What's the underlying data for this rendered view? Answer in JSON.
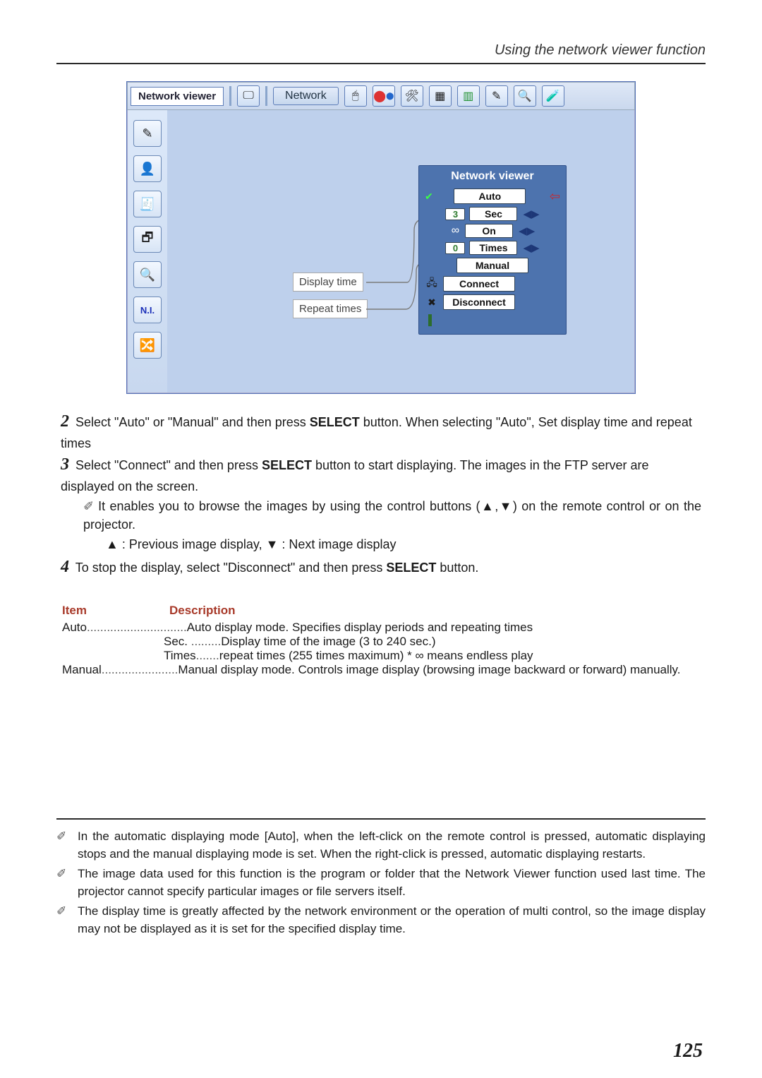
{
  "header": {
    "section_title": "Using the network viewer function"
  },
  "figure": {
    "header": {
      "title": "Network viewer",
      "tab_label": "Network",
      "pre_icons": [
        "dual-icon"
      ],
      "post_icons": [
        "mouse-icon",
        "rgb-balls-icon",
        "wrench-icon",
        "tiles-icon",
        "screen-icon",
        "pen-icon",
        "lens-icon",
        "probe-icon"
      ]
    },
    "sidebar": [
      {
        "name": "pen-tool-icon",
        "glyph": "✎"
      },
      {
        "name": "head-icon",
        "glyph": "👤"
      },
      {
        "name": "board-icon",
        "glyph": "🧾"
      },
      {
        "name": "windows-icon",
        "glyph": "🗗"
      },
      {
        "name": "lens-icon",
        "glyph": "🔍"
      },
      {
        "name": "ni-icon",
        "glyph": "N.I."
      },
      {
        "name": "swap-icon",
        "glyph": "🔀"
      }
    ],
    "panel": {
      "title": "Network viewer",
      "rows": {
        "auto": "Auto",
        "sec_value": "3",
        "sec_label": "Sec",
        "on_label": "On",
        "times_value": "0",
        "times_label": "Times",
        "manual": "Manual",
        "connect": "Connect",
        "disconnect": "Disconnect"
      }
    },
    "callouts": {
      "display_time": "Display time",
      "repeat_times": "Repeat times"
    }
  },
  "steps": {
    "s2a": "Select \"Auto\" or \"Manual\" and then press ",
    "s2b": " button. When selecting \"Auto\", Set display time and repeat times",
    "select": "SELECT",
    "s3a": "Select \"Connect\" and then press ",
    "s3b": " button to start displaying. The images in the FTP server are displayed on the  screen.",
    "s3note": "It enables you to browse the images by using the control buttons (▲,▼) on the remote control or on the projector.",
    "s3legend": "▲ : Previous image display,  ▼ : Next image display",
    "s4a": "To stop the display, select \"Disconnect\" and then press ",
    "s4b": " button."
  },
  "table": {
    "header": {
      "item": "Item",
      "desc": "Description"
    },
    "auto": {
      "label": "Auto",
      "dots": "..............................",
      "desc": "Auto display mode. Specifies display periods and repeating times"
    },
    "sec": {
      "label": "Sec.",
      "dots": " .........",
      "desc": "Display time of the image (3 to 240 sec.)"
    },
    "times": {
      "label": "Times",
      "dots": ".......",
      "desc": "repeat times (255 times maximum) * ∞ means endless play"
    },
    "man": {
      "label": "Manual",
      "dots": ".......................",
      "desc": "Manual display mode. Controls image display (browsing image backward or forward) manually."
    }
  },
  "notes": {
    "n1": "In the automatic displaying mode [Auto], when the left-click on the remote control is pressed, automatic displaying stops and the manual displaying mode is set. When the right-click is pressed, automatic displaying restarts.",
    "n2": "The image data used for this function is the program or folder that the Network Viewer function used last time. The projector cannot specify particular images or file servers itself.",
    "n3": "The display time is greatly affected by the network environment or the operation of multi control, so the image display may not be displayed as it is set for the specified display time."
  },
  "page_number": "125"
}
